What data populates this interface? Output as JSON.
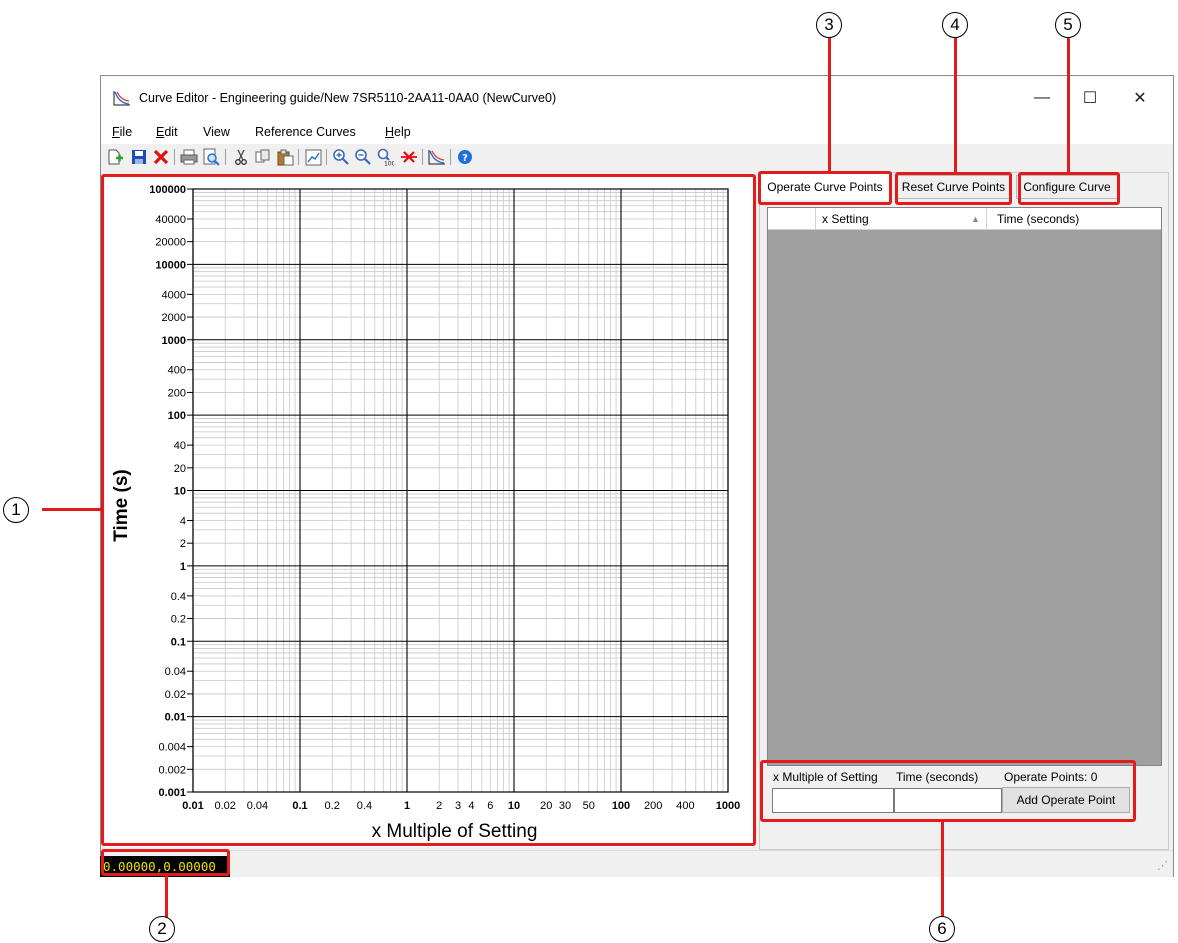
{
  "window": {
    "title": "Curve Editor - Engineering guide/New 7SR5110-2AA11-0AA0 (NewCurve0)",
    "controls": {
      "minimize": "—",
      "maximize": "☐",
      "close": "✕"
    }
  },
  "menu": {
    "file": {
      "key": "F",
      "rest": "ile"
    },
    "edit": {
      "key": "E",
      "rest": "dit"
    },
    "view": "View",
    "reference_curves": "Reference Curves",
    "help": {
      "key": "H",
      "rest": "elp"
    }
  },
  "toolbar": {
    "icons": [
      "new-curve-icon",
      "save-icon",
      "delete-icon",
      "print-icon",
      "print-preview-icon",
      "cut-icon",
      "copy-icon",
      "paste-icon",
      "chart-settings-icon",
      "zoom-in-icon",
      "zoom-out-icon",
      "zoom-100-icon",
      "remove-points-icon",
      "curve-icon",
      "help-icon"
    ],
    "colors": {
      "save": "#1a4fb5",
      "delete": "#e01010",
      "help": "#1e6fd9"
    }
  },
  "chart_data": {
    "type": "scatter",
    "title": "",
    "xlabel": "x Multiple of Setting",
    "ylabel": "Time (s)",
    "x_scale": "log",
    "y_scale": "log",
    "xlim": [
      0.01,
      1000
    ],
    "ylim": [
      0.001,
      100000
    ],
    "x_ticks": [
      {
        "v": 0.01,
        "label": "0.01",
        "bold": true
      },
      {
        "v": 0.02,
        "label": "0.02",
        "bold": false
      },
      {
        "v": 0.04,
        "label": "0.04",
        "bold": false
      },
      {
        "v": 0.1,
        "label": "0.1",
        "bold": true
      },
      {
        "v": 0.2,
        "label": "0.2",
        "bold": false
      },
      {
        "v": 0.4,
        "label": "0.4",
        "bold": false
      },
      {
        "v": 1,
        "label": "1",
        "bold": true
      },
      {
        "v": 2,
        "label": "2",
        "bold": false
      },
      {
        "v": 3,
        "label": "3",
        "bold": false
      },
      {
        "v": 4,
        "label": "4",
        "bold": false
      },
      {
        "v": 6,
        "label": "6",
        "bold": false
      },
      {
        "v": 10,
        "label": "10",
        "bold": true
      },
      {
        "v": 20,
        "label": "20",
        "bold": false
      },
      {
        "v": 30,
        "label": "30",
        "bold": false
      },
      {
        "v": 50,
        "label": "50",
        "bold": false
      },
      {
        "v": 100,
        "label": "100",
        "bold": true
      },
      {
        "v": 200,
        "label": "200",
        "bold": false
      },
      {
        "v": 400,
        "label": "400",
        "bold": false
      },
      {
        "v": 1000,
        "label": "1000",
        "bold": true
      }
    ],
    "y_ticks": [
      {
        "v": 100000,
        "label": "100000",
        "bold": true
      },
      {
        "v": 40000,
        "label": "40000",
        "bold": false
      },
      {
        "v": 20000,
        "label": "20000",
        "bold": false
      },
      {
        "v": 10000,
        "label": "10000",
        "bold": true
      },
      {
        "v": 4000,
        "label": "4000",
        "bold": false
      },
      {
        "v": 2000,
        "label": "2000",
        "bold": false
      },
      {
        "v": 1000,
        "label": "1000",
        "bold": true
      },
      {
        "v": 400,
        "label": "400",
        "bold": false
      },
      {
        "v": 200,
        "label": "200",
        "bold": false
      },
      {
        "v": 100,
        "label": "100",
        "bold": true
      },
      {
        "v": 40,
        "label": "40",
        "bold": false
      },
      {
        "v": 20,
        "label": "20",
        "bold": false
      },
      {
        "v": 10,
        "label": "10",
        "bold": true
      },
      {
        "v": 4,
        "label": "4",
        "bold": false
      },
      {
        "v": 2,
        "label": "2",
        "bold": false
      },
      {
        "v": 1,
        "label": "1",
        "bold": true
      },
      {
        "v": 0.4,
        "label": "0.4",
        "bold": false
      },
      {
        "v": 0.2,
        "label": "0.2",
        "bold": false
      },
      {
        "v": 0.1,
        "label": "0.1",
        "bold": true
      },
      {
        "v": 0.04,
        "label": "0.04",
        "bold": false
      },
      {
        "v": 0.02,
        "label": "0.02",
        "bold": false
      },
      {
        "v": 0.01,
        "label": "0.01",
        "bold": true
      },
      {
        "v": 0.004,
        "label": "0.004",
        "bold": false
      },
      {
        "v": 0.002,
        "label": "0.002",
        "bold": false
      },
      {
        "v": 0.001,
        "label": "0.001",
        "bold": true
      }
    ],
    "grid": true,
    "points": []
  },
  "tabs": {
    "operate": "Operate Curve Points",
    "reset": "Reset Curve Points",
    "configure": "Configure Curve"
  },
  "points_table": {
    "col_x": "x Setting",
    "col_time": "Time (seconds)",
    "rows": []
  },
  "add_point": {
    "x_label": "x Multiple of Setting",
    "time_label": "Time (seconds)",
    "count_label": "Operate Points: 0",
    "x_value": "",
    "time_value": "",
    "button": "Add Operate Point"
  },
  "status": {
    "coords": "0.00000,0.00000"
  },
  "callouts": [
    "1",
    "2",
    "3",
    "4",
    "5",
    "6"
  ]
}
